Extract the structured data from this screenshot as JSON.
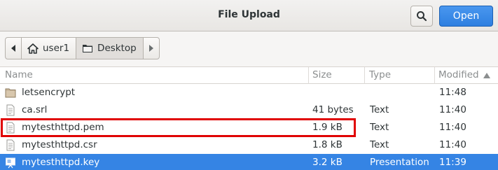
{
  "window": {
    "title": "File Upload",
    "open_label": "Open"
  },
  "path": {
    "items": [
      {
        "label": "user1",
        "icon": "home-icon"
      },
      {
        "label": "Desktop",
        "icon": "folder-icon"
      }
    ]
  },
  "columns": {
    "name": "Name",
    "size": "Size",
    "type": "Type",
    "modified": "Modified"
  },
  "files": [
    {
      "name": "letsencrypt",
      "size": "",
      "type": "",
      "modified": "11:48",
      "icon": "folder-icon"
    },
    {
      "name": "ca.srl",
      "size": "41 bytes",
      "type": "Text",
      "modified": "11:40",
      "icon": "text-file-icon"
    },
    {
      "name": "mytesthttpd.pem",
      "size": "1.9 kB",
      "type": "Text",
      "modified": "11:40",
      "icon": "text-file-icon"
    },
    {
      "name": "mytesthttpd.csr",
      "size": "1.8 kB",
      "type": "Text",
      "modified": "11:40",
      "icon": "text-file-icon"
    },
    {
      "name": "mytesthttpd.key",
      "size": "3.2 kB",
      "type": "Presentation",
      "modified": "11:39",
      "icon": "presentation-file-icon"
    }
  ],
  "colors": {
    "accent": "#3584e4",
    "highlight": "#e00000"
  }
}
